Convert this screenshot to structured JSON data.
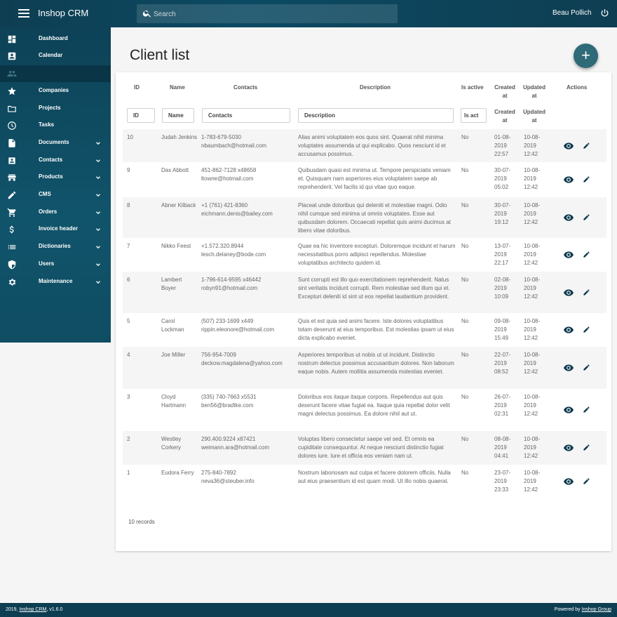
{
  "header": {
    "app_title": "Inshop CRM",
    "search_placeholder": "Search",
    "user_name": "Beau Pollich"
  },
  "sidebar": {
    "items": [
      {
        "label": "Dashboard",
        "icon": "dashboard-icon",
        "expandable": false
      },
      {
        "label": "Calendar",
        "icon": "calendar-icon",
        "expandable": false
      },
      {
        "label": "",
        "icon": "clients-icon",
        "expandable": false,
        "active": true
      },
      {
        "label": "Companies",
        "icon": "star-icon",
        "expandable": false
      },
      {
        "label": "Projects",
        "icon": "folder-icon",
        "expandable": false
      },
      {
        "label": "Tasks",
        "icon": "clock-icon",
        "expandable": false
      },
      {
        "label": "Documents",
        "icon": "document-icon",
        "expandable": true
      },
      {
        "label": "Contacts",
        "icon": "contacts-icon",
        "expandable": true
      },
      {
        "label": "Products",
        "icon": "store-icon",
        "expandable": true
      },
      {
        "label": "CMS",
        "icon": "pencil-icon",
        "expandable": true
      },
      {
        "label": "Orders",
        "icon": "cart-icon",
        "expandable": true
      },
      {
        "label": "Invoice header",
        "icon": "dollar-icon",
        "expandable": true
      },
      {
        "label": "Dictionaries",
        "icon": "list-icon",
        "expandable": true
      },
      {
        "label": "Users",
        "icon": "shield-icon",
        "expandable": true
      },
      {
        "label": "Maintenance",
        "icon": "gear-icon",
        "expandable": true
      }
    ]
  },
  "main": {
    "title": "Client list",
    "add_button": "+",
    "columns": {
      "id": "ID",
      "name": "Name",
      "contacts": "Contacts",
      "description": "Description",
      "active": "Is active",
      "created": "Created at",
      "updated": "Updated at",
      "actions": "Actions"
    },
    "filters": {
      "id": "ID",
      "name": "Name",
      "contacts": "Contacts",
      "description": "Description",
      "active": "Is act"
    },
    "sub_headers": {
      "created": "Created at",
      "updated": "Updated at"
    },
    "rows": [
      {
        "id": "10",
        "name": "Judah Jenkins",
        "phone": "1-783-679-5030",
        "email": "nbaumbach@hotmail.com",
        "description": "Alias animi voluptatem eos quos sint. Quaerat nihil minima voluptates assumenda ut qui explicabo. Quos nesciunt id et accusamus possimus.",
        "active": "No",
        "created": "01-08-2019 22:57",
        "updated": "10-08-2019 12:42"
      },
      {
        "id": "9",
        "name": "Dax Abbott",
        "phone": "451-862-7128 x48658",
        "email": "ltowne@hotmail.com",
        "description": "Quibusdam quasi est minima ut. Tempore perspiciatis veniam et. Quisquam nam asperiores eius voluptatem saepe ab reprehenderit. Vel facilis id qui vitae quo eaque.",
        "active": "No",
        "created": "30-07-2019 05:02",
        "updated": "10-08-2019 12:42"
      },
      {
        "id": "8",
        "name": "Abner Kilback",
        "phone": "+1 (761) 421-8360",
        "email": "eichmann.denis@bailey.com",
        "description": "Placeat unde doloribus qui deleniti et molestiae magni. Odio nihil cumque sed minima ut omnis voluptates. Esse aut quibusdam dolorem. Occaecati repellat quis animi ducimus at libero vitae doloribus.",
        "active": "No",
        "created": "30-07-2019 19:12",
        "updated": "10-08-2019 12:42"
      },
      {
        "id": "7",
        "name": "Nikko Feest",
        "phone": "+1.572.320.8944",
        "email": "lesch.delaney@bode.com",
        "description": "Quae ea hic inventore excepturi. Doloremque incidunt et harum necessitatibus porro adipisci repellendus. Molestiae voluptatibus architecto quidem id.",
        "active": "No",
        "created": "13-07-2019 22:17",
        "updated": "10-08-2019 12:42"
      },
      {
        "id": "6",
        "name": "Lambert Boyer",
        "phone": "1-796-614-9595 x46442",
        "email": "robyn91@hotmail.com",
        "description": "Sunt corrupti est illo quo exercitationem reprehenderit. Natus sint veritatis incidunt corrupti. Rem molestiae sed illum qui et. Excepturi deleniti id sint ut eos repellat laudantium provident.",
        "active": "No",
        "created": "02-08-2019 10:09",
        "updated": "10-08-2019 12:42"
      },
      {
        "id": "5",
        "name": "Carol Lockman",
        "phone": "(507) 233-1699 x449",
        "email": "rippin.eleonore@hotmail.com",
        "description": "Quis et est quia sed animi facere. Iste dolores voluptatibus totam deserunt at eius temporibus. Est molestias ipsam ut eius dicta explicabo eveniet.",
        "active": "No",
        "created": "09-08-2019 15:49",
        "updated": "10-08-2019 12:42"
      },
      {
        "id": "4",
        "name": "Joe Miller",
        "phone": "756-954-7009",
        "email": "deckow.magdalena@yahoo.com",
        "description": "Asperiores temporibus ut nobis ut ut incidunt. Distinctio nostrum delectus possimus accusantium dolores. Non laborum eaque nobis. Autem mollitia assumenda molestias eveniet.",
        "active": "No",
        "created": "22-07-2019 08:52",
        "updated": "10-08-2019 12:42"
      },
      {
        "id": "3",
        "name": "Cloyd Hartmann",
        "phone": "(335) 740-7663 x5531",
        "email": "ben56@bradtke.com",
        "description": "Doloribus eos itaque itaque corporis. Repellendus aut quis deserunt facere vitae fugiat ea. Itaque quia repellat dolor velit magni delectus possimus. Ea dolore nihil aut ut.",
        "active": "No",
        "created": "26-07-2019 02:31",
        "updated": "10-08-2019 12:42"
      },
      {
        "id": "2",
        "name": "Westley Corkery",
        "phone": "290.400.9224 x87421",
        "email": "weimann.ara@hotmail.com",
        "description": "Voluptas libero consectetur saepe vel sed. Et omnis ea cupiditate consequuntur. At neque nesciunt distinctio fugiat dolores iure. Iure et officia eos veniam nam ut.",
        "active": "No",
        "created": "08-08-2019 04:41",
        "updated": "10-08-2019 12:42"
      },
      {
        "id": "1",
        "name": "Eudora Ferry",
        "phone": "275-840-7892",
        "email": "neva36@steuber.info",
        "description": "Nostrum laboriosam aut culpa et facere dolorem officiis. Nulla aut eius praesentium id est quam modi. Ut illo nobis quaerat.",
        "active": "No",
        "created": "23-07-2019 23:33",
        "updated": "10-08-2019 12:42"
      }
    ],
    "records_text": "10 records"
  },
  "footer": {
    "left_prefix": "2019, ",
    "left_link": "Inshop CRM",
    "left_suffix": ", v1.6.0",
    "right_prefix": "Powered by ",
    "right_link": "Inshop Group"
  },
  "colors": {
    "topbar": "#0e3e52",
    "sidebar": "#10546b",
    "fab": "#2e6a78",
    "action_icon": "#0d3b4f"
  }
}
